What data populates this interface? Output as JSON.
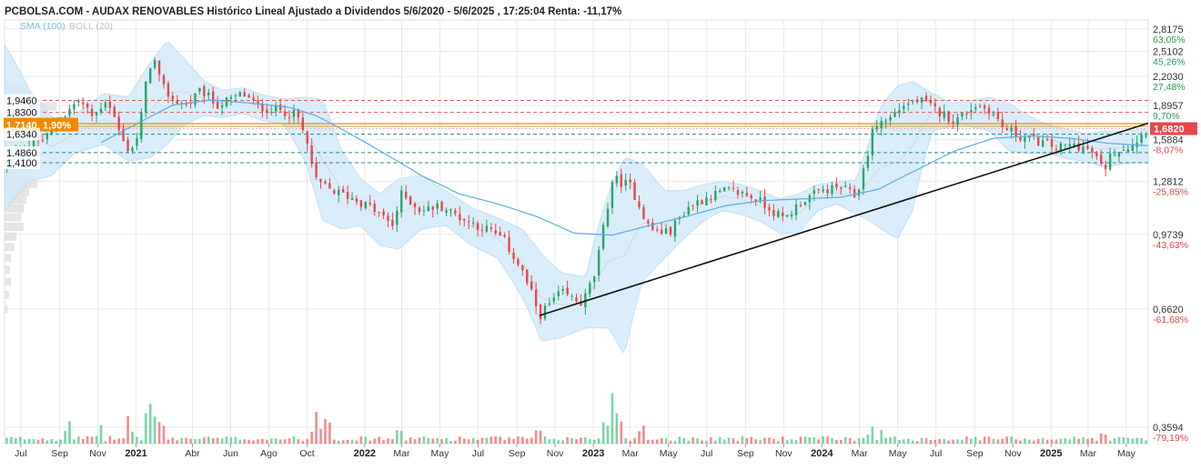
{
  "header": {
    "title": "PCBOLSA.COM - AUDAX RENOVABLES Histórico Lineal Ajustado a Dividendos 5/6/2020 - 5/6/2025 , 17:25:04 Renta: -11,17%",
    "legend_sma": "SMA (100)",
    "legend_boll": "BOLL (20)"
  },
  "colors": {
    "up": "#2aa36b",
    "down": "#e5484d",
    "sma": "#5aaee0",
    "boll_fill": "#d3eafa",
    "grid": "#e9e9e9",
    "support": "#2a8a80",
    "resistance": "#e05a5a",
    "highlight": "#f08a00",
    "last_price": "#e5484d"
  },
  "chart_data": {
    "type": "candlestick",
    "title": "PCBOLSA.COM - AUDAX RENOVABLES Histórico Lineal Ajustado a Dividendos 5/6/2020 - 5/6/2025 , 17:25:04 Renta: -11,17%",
    "x_range": [
      "2020-06-05",
      "2025-06-05"
    ],
    "y_scale": "log",
    "ylim": [
      0.33,
      2.95
    ],
    "grid": true,
    "right_axis": [
      {
        "price": "2,8175",
        "pct": "63,05%"
      },
      {
        "price": "2,5102",
        "pct": "45,26%"
      },
      {
        "price": "2,2030",
        "pct": "27,48%"
      },
      {
        "price": "1,8957",
        "pct": "9,70%"
      },
      {
        "price": "1,5884",
        "pct": "-8,07%"
      },
      {
        "price": "1,2812",
        "pct": "-25,85%"
      },
      {
        "price": "0,9739",
        "pct": "-43,63%"
      },
      {
        "price": "0,6620",
        "pct": "-61,68%"
      },
      {
        "price": "0,3594",
        "pct": "-79,19%"
      }
    ],
    "last_price": "1,6820",
    "x_ticks": [
      {
        "label": "Jul",
        "date": "2020-07-01",
        "year": false
      },
      {
        "label": "Sep",
        "date": "2020-09-01",
        "year": false
      },
      {
        "label": "Nov",
        "date": "2020-11-01",
        "year": false
      },
      {
        "label": "2021",
        "date": "2021-01-01",
        "year": true
      },
      {
        "label": "Abr",
        "date": "2021-04-01",
        "year": false
      },
      {
        "label": "Jun",
        "date": "2021-06-01",
        "year": false
      },
      {
        "label": "Ago",
        "date": "2021-08-01",
        "year": false
      },
      {
        "label": "Oct",
        "date": "2021-10-01",
        "year": false
      },
      {
        "label": "2022",
        "date": "2022-01-01",
        "year": true
      },
      {
        "label": "Mar",
        "date": "2022-03-01",
        "year": false
      },
      {
        "label": "May",
        "date": "2022-05-01",
        "year": false
      },
      {
        "label": "Jul",
        "date": "2022-07-01",
        "year": false
      },
      {
        "label": "Sep",
        "date": "2022-09-01",
        "year": false
      },
      {
        "label": "Nov",
        "date": "2022-11-01",
        "year": false
      },
      {
        "label": "2023",
        "date": "2023-01-01",
        "year": true
      },
      {
        "label": "Mar",
        "date": "2023-03-01",
        "year": false
      },
      {
        "label": "May",
        "date": "2023-05-01",
        "year": false
      },
      {
        "label": "Jul",
        "date": "2023-07-01",
        "year": false
      },
      {
        "label": "Sep",
        "date": "2023-09-01",
        "year": false
      },
      {
        "label": "Nov",
        "date": "2023-11-01",
        "year": false
      },
      {
        "label": "2024",
        "date": "2024-01-01",
        "year": true
      },
      {
        "label": "Mar",
        "date": "2024-03-01",
        "year": false
      },
      {
        "label": "May",
        "date": "2024-05-01",
        "year": false
      },
      {
        "label": "Jul",
        "date": "2024-07-01",
        "year": false
      },
      {
        "label": "Sep",
        "date": "2024-09-01",
        "year": false
      },
      {
        "label": "Nov",
        "date": "2024-11-01",
        "year": false
      },
      {
        "label": "2025",
        "date": "2025-01-01",
        "year": true
      },
      {
        "label": "Mar",
        "date": "2025-03-01",
        "year": false
      },
      {
        "label": "May",
        "date": "2025-05-01",
        "year": false
      }
    ],
    "levels": [
      {
        "label": "1,9460",
        "value": 1.946,
        "kind": "resistance"
      },
      {
        "label": "1,8300",
        "value": 1.83,
        "kind": "resistance"
      },
      {
        "label": "1,7140",
        "pct": "1,90%",
        "value": 1.714,
        "kind": "highlight"
      },
      {
        "label": "1,6340",
        "value": 1.634,
        "kind": "support"
      },
      {
        "label": "1,4860",
        "value": 1.486,
        "kind": "support"
      },
      {
        "label": "1,4100",
        "value": 1.41,
        "kind": "support"
      }
    ],
    "trendline": {
      "start": {
        "date": "2022-10-07",
        "price": 0.64
      },
      "end": {
        "date": "2025-06-05",
        "price": 1.73
      }
    },
    "price_anchors": [
      [
        "2020-06-05",
        1.4
      ],
      [
        "2020-07-01",
        1.52
      ],
      [
        "2020-08-10",
        1.6
      ],
      [
        "2020-09-01",
        1.75
      ],
      [
        "2020-10-01",
        1.95
      ],
      [
        "2020-10-25",
        1.78
      ],
      [
        "2020-11-15",
        1.97
      ],
      [
        "2020-12-10",
        1.58
      ],
      [
        "2020-12-22",
        1.5
      ],
      [
        "2021-01-05",
        1.62
      ],
      [
        "2021-01-20",
        2.25
      ],
      [
        "2021-01-28",
        2.45
      ],
      [
        "2021-02-10",
        2.1
      ],
      [
        "2021-03-01",
        1.95
      ],
      [
        "2021-03-25",
        1.9
      ],
      [
        "2021-04-15",
        2.05
      ],
      [
        "2021-05-10",
        1.9
      ],
      [
        "2021-06-01",
        1.95
      ],
      [
        "2021-06-20",
        2.02
      ],
      [
        "2021-07-15",
        1.88
      ],
      [
        "2021-08-20",
        1.85
      ],
      [
        "2021-09-15",
        1.8
      ],
      [
        "2021-10-01",
        1.55
      ],
      [
        "2021-10-15",
        1.28
      ],
      [
        "2021-11-10",
        1.22
      ],
      [
        "2021-12-10",
        1.18
      ],
      [
        "2022-01-10",
        1.12
      ],
      [
        "2022-02-15",
        1.02
      ],
      [
        "2022-03-01",
        1.2
      ],
      [
        "2022-04-01",
        1.1
      ],
      [
        "2022-05-01",
        1.13
      ],
      [
        "2022-06-10",
        1.05
      ],
      [
        "2022-07-15",
        1.0
      ],
      [
        "2022-08-10",
        0.95
      ],
      [
        "2022-09-10",
        0.8
      ],
      [
        "2022-10-07",
        0.64
      ],
      [
        "2022-11-10",
        0.72
      ],
      [
        "2022-12-15",
        0.68
      ],
      [
        "2023-01-05",
        0.8
      ],
      [
        "2023-01-20",
        1.05
      ],
      [
        "2023-02-01",
        1.3
      ],
      [
        "2023-03-01",
        1.25
      ],
      [
        "2023-04-01",
        1.0
      ],
      [
        "2023-05-01",
        0.98
      ],
      [
        "2023-06-01",
        1.12
      ],
      [
        "2023-07-01",
        1.18
      ],
      [
        "2023-08-01",
        1.22
      ],
      [
        "2023-09-01",
        1.2
      ],
      [
        "2023-10-01",
        1.14
      ],
      [
        "2023-11-01",
        1.05
      ],
      [
        "2023-12-01",
        1.16
      ],
      [
        "2024-01-01",
        1.22
      ],
      [
        "2024-02-01",
        1.24
      ],
      [
        "2024-02-25",
        1.18
      ],
      [
        "2024-03-10",
        1.4
      ],
      [
        "2024-03-25",
        1.72
      ],
      [
        "2024-04-15",
        1.76
      ],
      [
        "2024-05-10",
        1.9
      ],
      [
        "2024-06-05",
        1.95
      ],
      [
        "2024-07-01",
        1.85
      ],
      [
        "2024-08-01",
        1.75
      ],
      [
        "2024-09-01",
        1.9
      ],
      [
        "2024-09-25",
        1.86
      ],
      [
        "2024-10-15",
        1.7
      ],
      [
        "2024-11-10",
        1.62
      ],
      [
        "2024-12-10",
        1.58
      ],
      [
        "2025-01-10",
        1.52
      ],
      [
        "2025-02-10",
        1.55
      ],
      [
        "2025-03-10",
        1.48
      ],
      [
        "2025-03-25",
        1.35
      ],
      [
        "2025-04-10",
        1.5
      ],
      [
        "2025-05-10",
        1.55
      ],
      [
        "2025-06-05",
        1.682
      ]
    ],
    "sma_anchors": [
      [
        "2020-11-01",
        1.55
      ],
      [
        "2021-01-01",
        1.72
      ],
      [
        "2021-03-01",
        1.9
      ],
      [
        "2021-05-01",
        1.95
      ],
      [
        "2021-07-01",
        1.92
      ],
      [
        "2021-09-01",
        1.88
      ],
      [
        "2021-10-15",
        1.8
      ],
      [
        "2021-12-01",
        1.66
      ],
      [
        "2022-02-01",
        1.48
      ],
      [
        "2022-04-01",
        1.32
      ],
      [
        "2022-06-01",
        1.2
      ],
      [
        "2022-08-01",
        1.14
      ],
      [
        "2022-10-01",
        1.07
      ],
      [
        "2022-12-01",
        0.98
      ],
      [
        "2023-02-01",
        0.97
      ],
      [
        "2023-04-01",
        1.02
      ],
      [
        "2023-06-01",
        1.07
      ],
      [
        "2023-08-01",
        1.13
      ],
      [
        "2023-10-01",
        1.16
      ],
      [
        "2023-12-01",
        1.17
      ],
      [
        "2024-02-01",
        1.18
      ],
      [
        "2024-04-01",
        1.23
      ],
      [
        "2024-06-01",
        1.36
      ],
      [
        "2024-08-01",
        1.5
      ],
      [
        "2024-10-01",
        1.6
      ],
      [
        "2024-12-01",
        1.62
      ],
      [
        "2025-02-01",
        1.6
      ],
      [
        "2025-04-01",
        1.56
      ],
      [
        "2025-06-05",
        1.54
      ]
    ],
    "boll_anchors": [
      [
        "2020-06-05",
        2.6,
        1.1
      ],
      [
        "2020-07-15",
        2.05,
        1.28
      ],
      [
        "2020-08-20",
        1.78,
        1.32
      ],
      [
        "2020-09-25",
        1.8,
        1.48
      ],
      [
        "2020-11-10",
        2.02,
        1.55
      ],
      [
        "2020-12-20",
        1.98,
        1.42
      ],
      [
        "2021-01-25",
        2.38,
        1.45
      ],
      [
        "2021-02-20",
        2.65,
        1.55
      ],
      [
        "2021-03-20",
        2.4,
        1.72
      ],
      [
        "2021-04-20",
        2.15,
        1.8
      ],
      [
        "2021-05-20",
        2.05,
        1.78
      ],
      [
        "2021-06-20",
        2.08,
        1.82
      ],
      [
        "2021-07-25",
        2.0,
        1.75
      ],
      [
        "2021-08-25",
        1.96,
        1.72
      ],
      [
        "2021-09-25",
        1.98,
        1.45
      ],
      [
        "2021-10-25",
        1.96,
        1.05
      ],
      [
        "2021-11-25",
        1.5,
        1.0
      ],
      [
        "2021-12-25",
        1.3,
        1.02
      ],
      [
        "2022-01-25",
        1.2,
        0.92
      ],
      [
        "2022-02-25",
        1.3,
        0.9
      ],
      [
        "2022-04-01",
        1.32,
        1.0
      ],
      [
        "2022-05-10",
        1.22,
        1.02
      ],
      [
        "2022-06-20",
        1.12,
        0.92
      ],
      [
        "2022-08-01",
        1.06,
        0.86
      ],
      [
        "2022-09-10",
        1.0,
        0.7
      ],
      [
        "2022-10-10",
        0.88,
        0.56
      ],
      [
        "2022-11-10",
        0.8,
        0.57
      ],
      [
        "2022-12-20",
        0.78,
        0.6
      ],
      [
        "2023-01-25",
        1.2,
        0.6
      ],
      [
        "2023-02-20",
        1.45,
        0.52
      ],
      [
        "2023-03-20",
        1.4,
        0.76
      ],
      [
        "2023-04-25",
        1.22,
        0.86
      ],
      [
        "2023-05-25",
        1.22,
        0.95
      ],
      [
        "2023-06-25",
        1.26,
        1.04
      ],
      [
        "2023-07-25",
        1.28,
        1.1
      ],
      [
        "2023-08-25",
        1.26,
        1.08
      ],
      [
        "2023-09-25",
        1.22,
        1.04
      ],
      [
        "2023-10-25",
        1.17,
        0.98
      ],
      [
        "2023-11-25",
        1.2,
        0.98
      ],
      [
        "2023-12-25",
        1.26,
        1.1
      ],
      [
        "2024-01-25",
        1.28,
        1.14
      ],
      [
        "2024-02-25",
        1.29,
        1.08
      ],
      [
        "2024-03-15",
        1.55,
        1.05
      ],
      [
        "2024-04-05",
        1.9,
        1.0
      ],
      [
        "2024-05-01",
        2.1,
        0.95
      ],
      [
        "2024-05-25",
        2.15,
        1.1
      ],
      [
        "2024-06-25",
        2.02,
        1.66
      ],
      [
        "2024-07-25",
        1.92,
        1.7
      ],
      [
        "2024-08-25",
        1.94,
        1.7
      ],
      [
        "2024-09-25",
        1.98,
        1.66
      ],
      [
        "2024-10-25",
        1.92,
        1.5
      ],
      [
        "2024-11-25",
        1.8,
        1.48
      ],
      [
        "2024-12-25",
        1.72,
        1.48
      ],
      [
        "2025-01-25",
        1.68,
        1.44
      ],
      [
        "2025-02-25",
        1.64,
        1.42
      ],
      [
        "2025-03-25",
        1.66,
        1.38
      ],
      [
        "2025-04-25",
        1.66,
        1.4
      ],
      [
        "2025-06-05",
        1.68,
        1.42
      ]
    ],
    "volume_spikes": [
      [
        "2020-09-15",
        0.4
      ],
      [
        "2020-11-05",
        0.3
      ],
      [
        "2020-12-20",
        0.45
      ],
      [
        "2021-01-21",
        0.8
      ],
      [
        "2021-01-27",
        0.65
      ],
      [
        "2021-02-10",
        0.45
      ],
      [
        "2021-10-15",
        0.5
      ],
      [
        "2021-10-28",
        0.45
      ],
      [
        "2021-11-05",
        0.35
      ],
      [
        "2022-02-25",
        0.3
      ],
      [
        "2022-10-05",
        0.3
      ],
      [
        "2023-01-20",
        0.45
      ],
      [
        "2023-02-01",
        0.8
      ],
      [
        "2023-02-10",
        0.6
      ],
      [
        "2023-03-20",
        0.35
      ],
      [
        "2024-03-20",
        0.3
      ],
      [
        "2024-04-05",
        0.2
      ],
      [
        "2025-03-25",
        0.22
      ]
    ],
    "volume_profile_left": [
      {
        "price": 2.1,
        "size": 0.4
      },
      {
        "price": 2.02,
        "size": 0.45
      },
      {
        "price": 1.95,
        "size": 0.55
      },
      {
        "price": 1.88,
        "size": 0.95
      },
      {
        "price": 1.82,
        "size": 0.8
      },
      {
        "price": 1.76,
        "size": 0.7
      },
      {
        "price": 1.71,
        "size": 1.0
      },
      {
        "price": 1.66,
        "size": 0.85
      },
      {
        "price": 1.61,
        "size": 0.75
      },
      {
        "price": 1.56,
        "size": 0.55
      },
      {
        "price": 1.51,
        "size": 0.6
      },
      {
        "price": 1.46,
        "size": 0.5
      },
      {
        "price": 1.41,
        "size": 0.6
      },
      {
        "price": 1.36,
        "size": 0.5
      },
      {
        "price": 1.31,
        "size": 0.55
      },
      {
        "price": 1.26,
        "size": 0.6
      },
      {
        "price": 1.21,
        "size": 0.45
      },
      {
        "price": 1.16,
        "size": 0.4
      },
      {
        "price": 1.11,
        "size": 0.35
      },
      {
        "price": 1.06,
        "size": 0.3
      },
      {
        "price": 1.01,
        "size": 0.35
      },
      {
        "price": 0.96,
        "size": 0.22
      },
      {
        "price": 0.91,
        "size": 0.18
      },
      {
        "price": 0.86,
        "size": 0.12
      },
      {
        "price": 0.81,
        "size": 0.1
      },
      {
        "price": 0.76,
        "size": 0.12
      },
      {
        "price": 0.71,
        "size": 0.08
      },
      {
        "price": 0.66,
        "size": 0.06
      }
    ]
  }
}
